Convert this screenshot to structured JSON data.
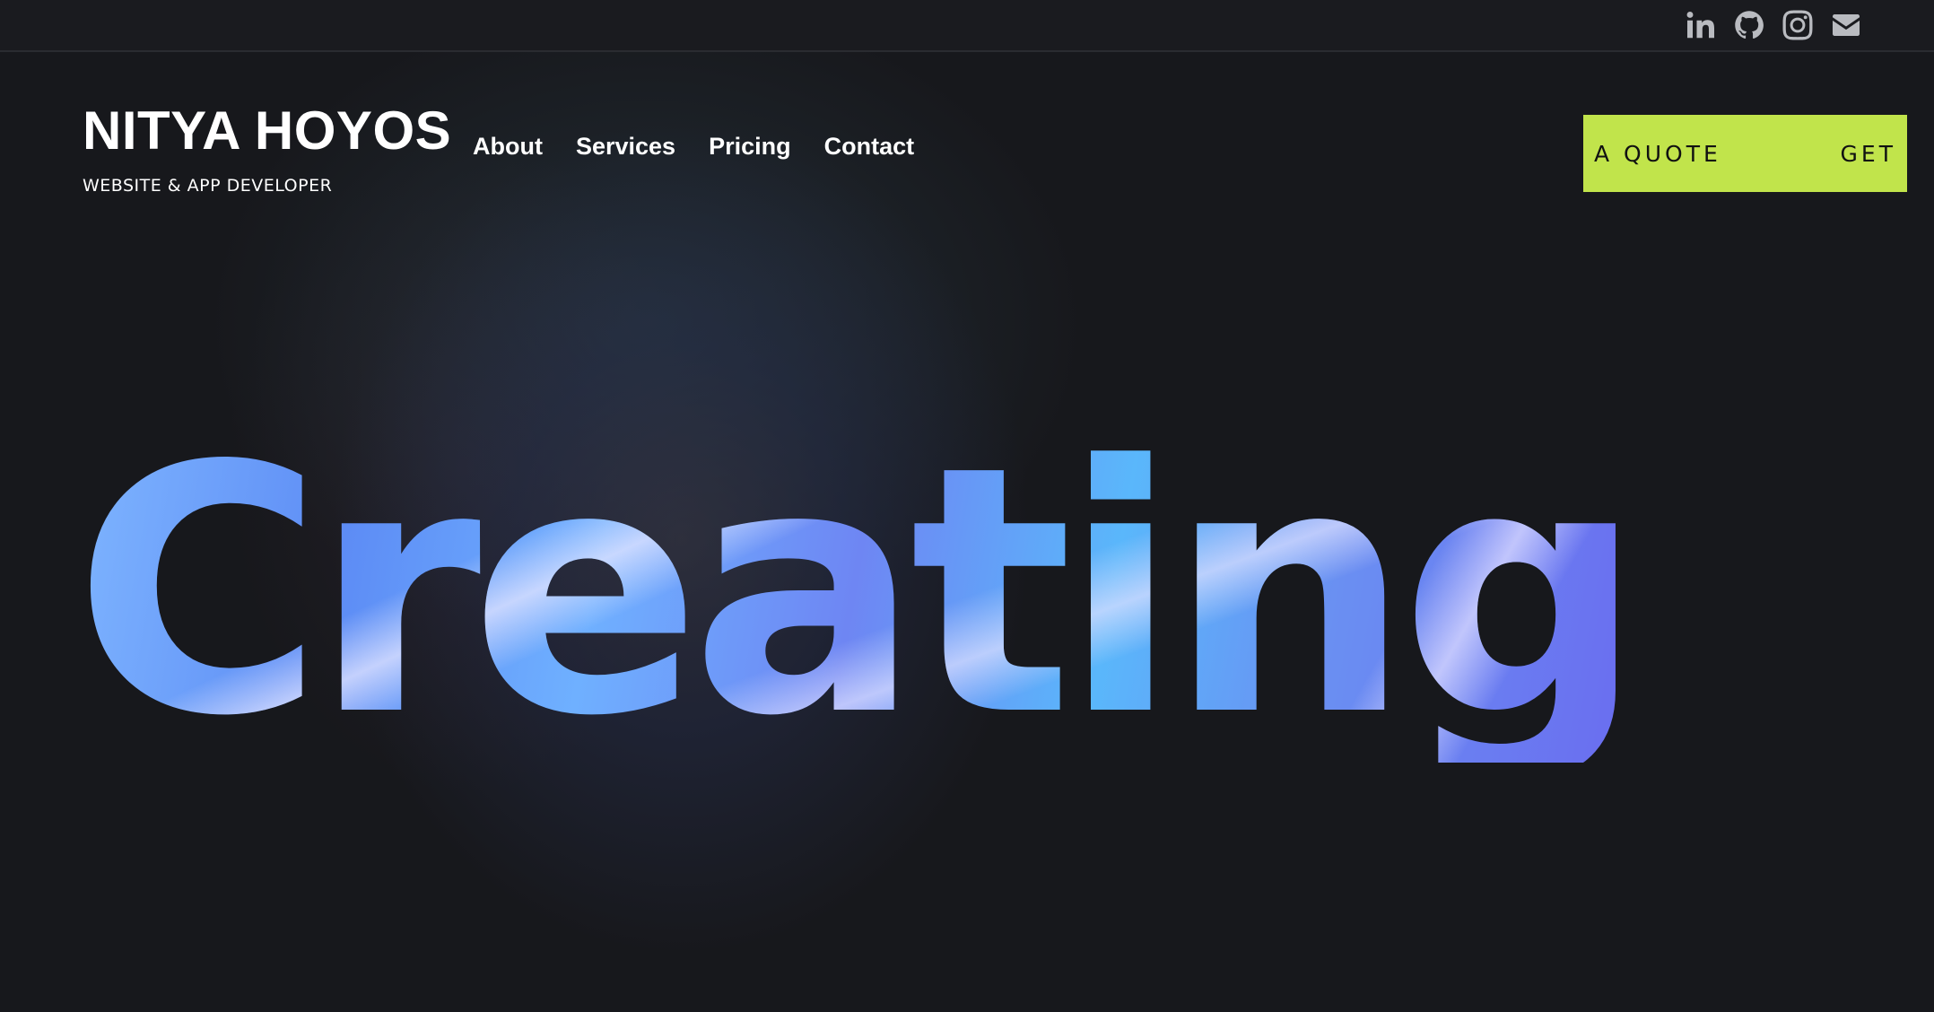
{
  "topbar": {
    "social": [
      {
        "name": "linkedin-icon"
      },
      {
        "name": "github-icon"
      },
      {
        "name": "instagram-icon"
      },
      {
        "name": "email-icon"
      }
    ]
  },
  "header": {
    "brand_name": "NITYA HOYOS",
    "brand_sub": "WEBSITE & APP DEVELOPER",
    "nav": [
      "About",
      "Services",
      "Pricing",
      "Contact"
    ],
    "quote_left": "A QUOTE",
    "quote_right": "GET"
  },
  "hero": {
    "word": "Creating"
  },
  "colors": {
    "background": "#17181c",
    "accent": "#c1e44b",
    "icon": "#b9bbc0"
  }
}
